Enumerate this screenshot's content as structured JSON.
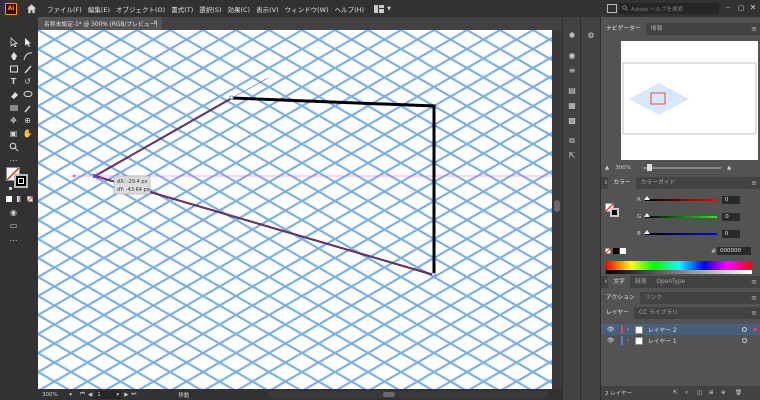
{
  "menubar": {
    "items": [
      "ファイル(F)",
      "編集(E)",
      "オブジェクト(O)",
      "書式(T)",
      "選択(S)",
      "効果(C)",
      "表示(V)",
      "ウィンドウ(W)",
      "ヘルプ(H)"
    ],
    "search_placeholder": "Adobe ヘルプを検索"
  },
  "document": {
    "tab_title": "名称未設定-1* @ 300% (RGB/プレビュー)",
    "tab_close": "×"
  },
  "canvas": {
    "tooltip_dx": "dX: -29.4 px",
    "tooltip_dy": "dY: -43.64 px"
  },
  "statusbar": {
    "zoom": "300%",
    "page": "1",
    "mode": "移動"
  },
  "panels": {
    "navigator_tab": "ナビゲーター",
    "info_tab": "情報",
    "navigator_zoom": "300%",
    "color_tab": "カラー",
    "color_guide_tab": "カラーガイド",
    "r_label": "R",
    "g_label": "G",
    "b_label": "B",
    "r_value": "0",
    "g_value": "0",
    "b_value": "0",
    "hex_label": "#",
    "hex_value": "000000",
    "type_tabs": [
      "文字",
      "段落",
      "OpenType"
    ],
    "action_tabs": [
      "アクション",
      "リンク"
    ],
    "layers_tabs": [
      "レイヤー",
      "CC ライブラリ"
    ],
    "layers": [
      {
        "name": "レイヤー 2",
        "color": "#e0464d",
        "selected": true
      },
      {
        "name": "レイヤー 1",
        "color": "#4a7ee8",
        "selected": false
      }
    ],
    "layers_count": "2 レイヤー"
  },
  "colors": {
    "chrome_dark": "#323232",
    "chrome_mid": "#424242",
    "panel_bg": "#535353",
    "grid_blue": "#7bb1ea",
    "smart_guide": "#ff4cff",
    "selected_layer": "#46607e"
  }
}
